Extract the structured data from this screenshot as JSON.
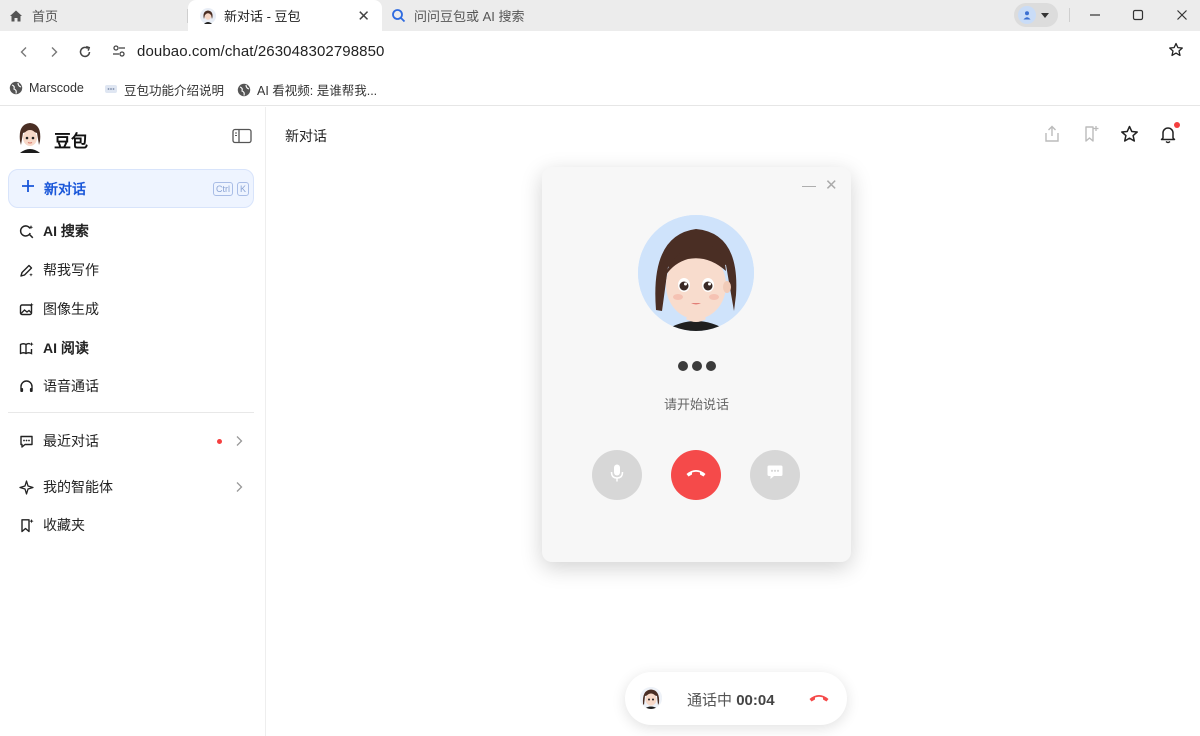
{
  "browser": {
    "tabs": [
      {
        "label": "首页",
        "icon": "home-icon"
      },
      {
        "label": "新对话 - 豆包",
        "icon": "doubao-avatar-icon",
        "active": true
      },
      {
        "label": "问问豆包或 AI 搜索",
        "icon": "ai-search-icon"
      }
    ],
    "url": "doubao.com/chat/263048302798850",
    "bookmarks": [
      {
        "label": "Marscode",
        "icon": "globe-icon"
      },
      {
        "label": "豆包功能介绍说明",
        "icon": "chat-bubble-icon"
      },
      {
        "label": "AI 看视频: 是谁帮我...",
        "icon": "globe-icon"
      }
    ]
  },
  "sidebar": {
    "brand": "豆包",
    "new_chat": {
      "label": "新对话",
      "shortcut_1": "Ctrl",
      "shortcut_2": "K"
    },
    "items": [
      {
        "label": "AI 搜索",
        "icon": "ai-search-icon"
      },
      {
        "label": "帮我写作",
        "icon": "pen-icon"
      },
      {
        "label": "图像生成",
        "icon": "image-icon"
      },
      {
        "label": "AI 阅读",
        "icon": "book-icon"
      },
      {
        "label": "语音通话",
        "icon": "headphones-icon"
      }
    ],
    "recent": {
      "label": "最近对话",
      "icon": "chat-icon"
    },
    "agents": {
      "label": "我的智能体",
      "icon": "sparkle-icon"
    },
    "favorites": {
      "label": "收藏夹",
      "icon": "bookmark-icon"
    }
  },
  "main": {
    "title": "新对话"
  },
  "call": {
    "hint": "请开始说话",
    "status_label": "通话中",
    "time": "00:04"
  },
  "colors": {
    "accent": "#1a57d9",
    "hangup": "#f54a4a",
    "badge": "#f53f3f"
  }
}
